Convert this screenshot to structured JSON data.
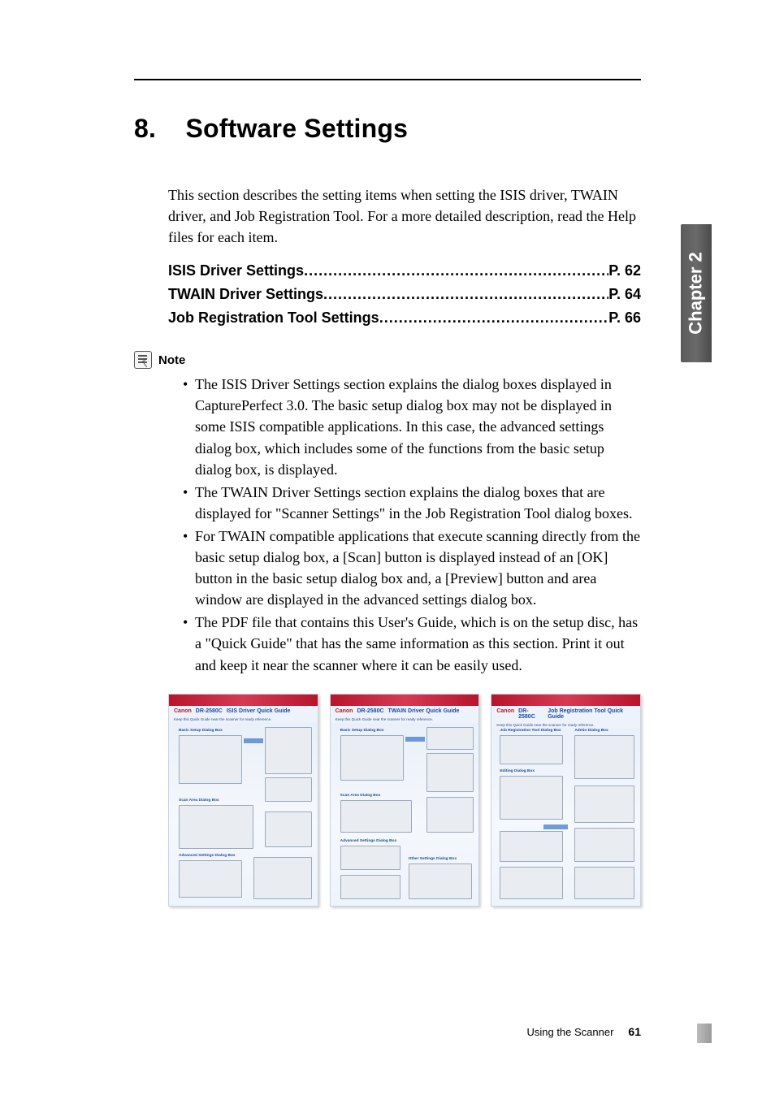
{
  "chapter": {
    "number": "8.",
    "title": "Software Settings"
  },
  "intro": "This section describes the setting items when setting the ISIS driver, TWAIN driver, and Job Registration Tool. For a more detailed description, read the Help files for each item.",
  "toc": {
    "dots": "............................................................................................................................",
    "items": [
      {
        "label": "ISIS Driver Settings",
        "page": "P. 62"
      },
      {
        "label": "TWAIN Driver Settings",
        "page": "P. 64"
      },
      {
        "label": "Job Registration Tool Settings",
        "page": "P. 66"
      }
    ]
  },
  "note": {
    "label": "Note",
    "items": [
      "The ISIS Driver Settings section explains the dialog boxes displayed in CapturePerfect 3.0. The basic setup dialog box may not be displayed in some ISIS compatible applications. In this case, the advanced settings dialog box, which includes some of the functions from the basic setup dialog box, is displayed.",
      "The TWAIN Driver Settings section explains the dialog boxes that are displayed for \"Scanner Settings\" in the Job Registration Tool dialog boxes.",
      "For TWAIN compatible applications that execute scanning directly from the basic setup dialog box, a [Scan] button is displayed instead of an [OK] button in the basic setup dialog box and, a [Preview] button and area window are displayed in the advanced settings dialog box.",
      "The PDF file that contains this User's Guide, which is on the setup disc, has a \"Quick Guide\" that has the same information as this section. Print it out and keep it near the scanner where it can be easily used."
    ]
  },
  "thumbs": {
    "brand": "Canon",
    "model": "DR-2580C",
    "sub": "Keep this Quick Guide near the scanner for ready reference.",
    "titles": [
      "ISIS Driver Quick Guide",
      "TWAIN Driver Quick Guide",
      "Job Registration Tool Quick Guide"
    ],
    "sections": {
      "t1_a": "Basic Setup Dialog Box",
      "t1_b": "Scan Area Dialog Box",
      "t1_c": "Advanced Settings Dialog Box",
      "t2_a": "Basic Setup Dialog Box",
      "t2_b": "Scan Area Dialog Box",
      "t2_c": "Advanced Settings Dialog Box",
      "t2_d": "Other Settings Dialog Box",
      "t3_a": "Job Registration Tool Dialog Box",
      "t3_b": "Editing Dialog Box",
      "t3_c": "Admin Dialog Box"
    }
  },
  "sidebar": "Chapter 2",
  "footer": {
    "section": "Using the Scanner",
    "page": "61"
  }
}
